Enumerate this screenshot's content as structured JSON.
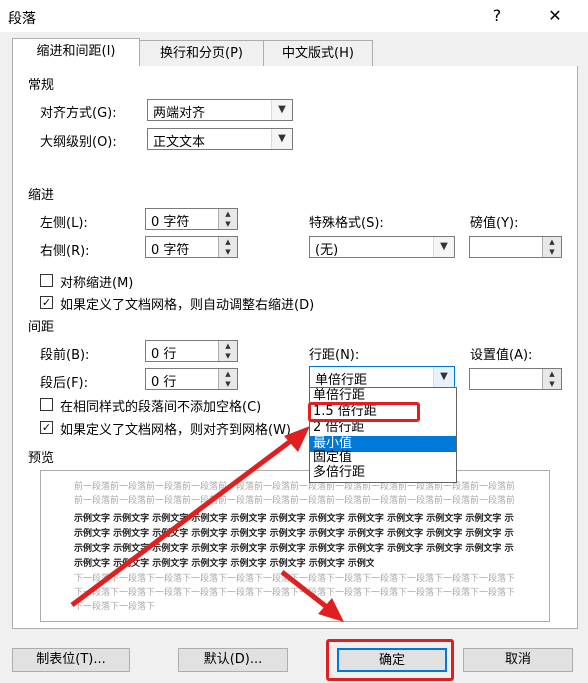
{
  "dialog": {
    "title": "段落",
    "help": "?",
    "close": "✕"
  },
  "tabs": [
    "缩进和间距(I)",
    "换行和分页(P)",
    "中文版式(H)"
  ],
  "general": {
    "heading": "常规",
    "alignment_label": "对齐方式(G):",
    "alignment_value": "两端对齐",
    "outline_label": "大纲级别(O):",
    "outline_value": "正文文本"
  },
  "indent": {
    "heading": "缩进",
    "left_label": "左侧(L):",
    "left_value": "0 字符",
    "right_label": "右侧(R):",
    "right_value": "0 字符",
    "special_label": "特殊格式(S):",
    "special_value": "(无)",
    "by_label": "磅值(Y):",
    "by_value": "",
    "mirror_label": "对称缩进(M)",
    "auto_adjust_label": "如果定义了文档网格，则自动调整右缩进(D)"
  },
  "spacing": {
    "heading": "间距",
    "before_label": "段前(B):",
    "before_value": "0 行",
    "after_label": "段后(F):",
    "after_value": "0 行",
    "line_spacing_label": "行距(N):",
    "line_spacing_value": "单倍行距",
    "at_label": "设置值(A):",
    "at_value": "",
    "no_space_label": "在相同样式的段落间不添加空格(C)",
    "snap_grid_label": "如果定义了文档网格，则对齐到网格(W)",
    "options": [
      "单倍行距",
      "1.5 倍行距",
      "2 倍行距",
      "最小值",
      "固定值",
      "多倍行距"
    ],
    "highlighted_option": "最小值"
  },
  "preview": {
    "heading": "预览",
    "prev_text": "前一段落前一段落前一段落前一段落前一段落前一段落前一段落前一段落前一段落前一段落前一段落前一段落前一段落前一段落前一段落前一段落前一段落前一段落",
    "sample_text": "示例文字 示例文字 示例文字 示例文字 示例文字 示例文字 示例文字 示例文字 示例文字 示例文字 示例文字 示例文字 示例文字 示例文字 示例文字 示例文字 示例文字 示例文字 示例文字 示例文字 示例文字 示例文字 示例文字 示例文字 示例文字 示例文字 示例文字",
    "next_text": "下一段落下一段落下一段落下一段落下一段落下一段落下一段落下一段落下一段落下一段落下一段落下一段落下一段落下一段落下一段落下一段落下一段落下一段落下一段落下一段落"
  },
  "buttons": {
    "tabs": "制表位(T)...",
    "default": "默认(D)...",
    "ok": "确定",
    "cancel": "取消"
  },
  "annotation_color": "#e02020"
}
